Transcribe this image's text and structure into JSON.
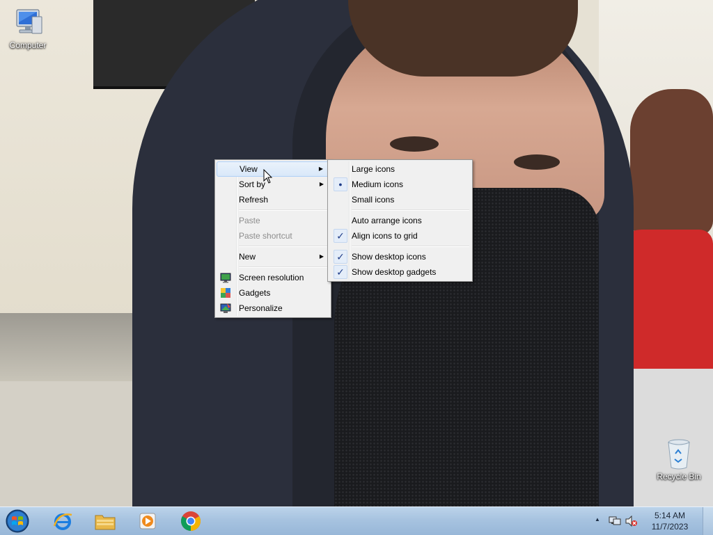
{
  "desktop": {
    "icons": [
      {
        "label": "Computer"
      },
      {
        "label": "Recycle Bin"
      }
    ]
  },
  "context_menu": {
    "items": [
      {
        "label": "View",
        "has_submenu": true,
        "highlighted": true
      },
      {
        "label": "Sort by",
        "has_submenu": true
      },
      {
        "label": "Refresh"
      },
      {
        "label": "Paste",
        "disabled": true
      },
      {
        "label": "Paste shortcut",
        "disabled": true
      },
      {
        "label": "New",
        "has_submenu": true
      },
      {
        "label": "Screen resolution",
        "icon": "screen-resolution-icon"
      },
      {
        "label": "Gadgets",
        "icon": "gadgets-icon"
      },
      {
        "label": "Personalize",
        "icon": "personalize-icon"
      }
    ]
  },
  "view_submenu": {
    "items": [
      {
        "label": "Large icons"
      },
      {
        "label": "Medium icons",
        "selected": true
      },
      {
        "label": "Small icons"
      },
      {
        "label": "Auto arrange icons"
      },
      {
        "label": "Align icons to grid",
        "checked": true
      },
      {
        "label": "Show desktop icons",
        "checked": true
      },
      {
        "label": "Show desktop gadgets",
        "checked": true
      }
    ]
  },
  "taskbar": {
    "pinned": [
      "internet-explorer-icon",
      "windows-explorer-icon",
      "media-player-icon",
      "chrome-icon"
    ],
    "clock": {
      "time": "5:14 AM",
      "date": "11/7/2023"
    }
  },
  "colors": {
    "taskbar": "#a7c3e0",
    "menu_bg": "#f0f0f0",
    "check": "#1f3c88"
  }
}
